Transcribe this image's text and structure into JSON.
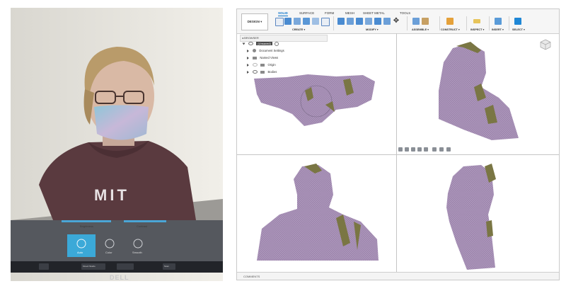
{
  "photo": {
    "shirt_text": "MIT",
    "slider_left_label": "Brightness",
    "slider_right_label": "Contrast",
    "option_labels": [
      "Auto",
      "Color",
      "Smooth"
    ],
    "taskbar_items": [
      "",
      "Kinect Studio",
      "",
      "Scan"
    ],
    "monitor_brand": "DELL"
  },
  "app": {
    "workspace_label": "DESIGN",
    "tabs": [
      "SOLID",
      "SURFACE",
      "FORM",
      "MESH",
      "SHEET METAL",
      "TOOLS"
    ],
    "active_tab": "SOLID",
    "groups": [
      "CREATE",
      "MODIFY",
      "ASSEMBLE",
      "CONSTRUCT",
      "INSPECT",
      "INSERT",
      "SELECT"
    ],
    "browser_title": "BROWSER",
    "tree": {
      "root": "(Unsaved)",
      "items": [
        "Document Settings",
        "Named Views",
        "Origin",
        "Bodies"
      ]
    },
    "comments_label": "COMMENTS"
  },
  "colors": {
    "mesh_purple": "#9e86ad",
    "mesh_olive": "#7a7644",
    "accent_blue": "#0b73c9",
    "hoodie": "#5a3a3f"
  }
}
